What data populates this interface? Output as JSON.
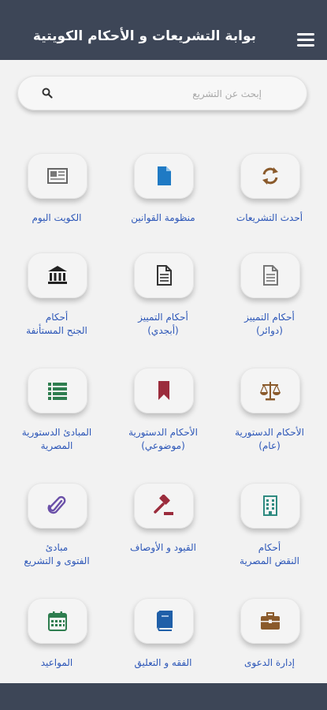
{
  "header": {
    "title": "بوابة التشريعات و الأحكام الكويتية"
  },
  "search": {
    "placeholder": "إبحث عن التشريع",
    "value": ""
  },
  "grid": {
    "items": [
      {
        "label": "أحدث التشريعات",
        "icon": "refresh-icon"
      },
      {
        "label": "منظومة القوانين",
        "icon": "document-icon"
      },
      {
        "label": "الكويت اليوم",
        "icon": "newspaper-icon"
      },
      {
        "label": "أحكام التمييز\n(دوائر)",
        "icon": "file-text-icon"
      },
      {
        "label": "أحكام التمييز\n(أبجدي)",
        "icon": "file-text-icon"
      },
      {
        "label": "أحكام\nالجنح المستأنفة",
        "icon": "courthouse-icon"
      },
      {
        "label": "الأحكام الدستورية\n(عام)",
        "icon": "scales-icon"
      },
      {
        "label": "الأحكام الدستورية\n(موضوعي)",
        "icon": "bookmark-icon"
      },
      {
        "label": "المبادئ الدستورية\nالمصرية",
        "icon": "list-icon"
      },
      {
        "label": "أحكام\nالنقض المصرية",
        "icon": "building-icon"
      },
      {
        "label": "القيود و الأوصاف",
        "icon": "gavel-icon"
      },
      {
        "label": "مبادئ\nالفتوى و التشريع",
        "icon": "paperclip-icon"
      },
      {
        "label": "إدارة الدعوى",
        "icon": "briefcase-icon"
      },
      {
        "label": "الفقه و التعليق",
        "icon": "book-icon"
      },
      {
        "label": "المواعيد",
        "icon": "calendar-icon"
      }
    ]
  },
  "colors": {
    "header_bg": "#3d4657",
    "label_blue": "#2d57b8",
    "icon_brown": "#8a5a2b",
    "icon_blue": "#1f7ac4",
    "icon_dark": "#333333",
    "icon_red": "#9b2c3c",
    "icon_green": "#2e7d4f"
  }
}
